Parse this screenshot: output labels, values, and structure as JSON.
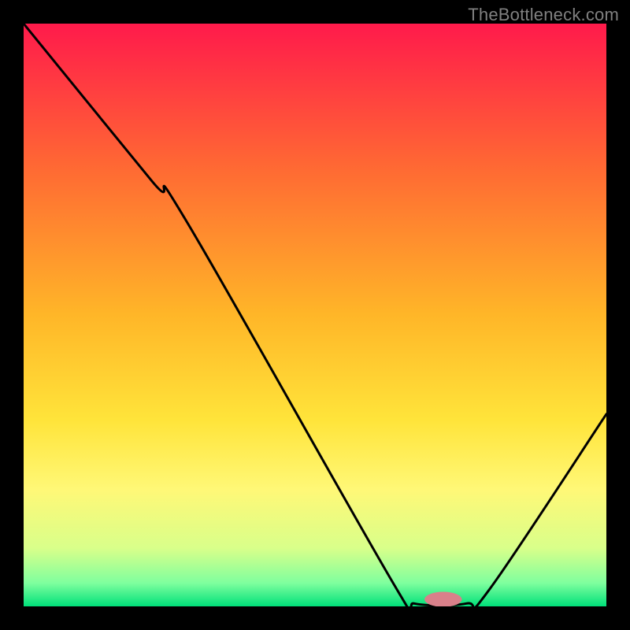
{
  "watermark": "TheBottleneck.com",
  "chart_data": {
    "type": "line",
    "title": "",
    "xlabel": "",
    "ylabel": "",
    "xlim": [
      0,
      100
    ],
    "ylim": [
      0,
      100
    ],
    "background_gradient_stops": [
      {
        "offset": 0,
        "color": "#ff1a4b"
      },
      {
        "offset": 25,
        "color": "#ff6a33"
      },
      {
        "offset": 50,
        "color": "#ffb628"
      },
      {
        "offset": 68,
        "color": "#ffe43a"
      },
      {
        "offset": 80,
        "color": "#fff877"
      },
      {
        "offset": 90,
        "color": "#d9ff8a"
      },
      {
        "offset": 96,
        "color": "#7fff9e"
      },
      {
        "offset": 100,
        "color": "#00e07a"
      }
    ],
    "series": [
      {
        "name": "bottleneck-curve",
        "points": [
          {
            "x": 0,
            "y": 100
          },
          {
            "x": 22,
            "y": 73
          },
          {
            "x": 28,
            "y": 66
          },
          {
            "x": 64,
            "y": 3
          },
          {
            "x": 67,
            "y": 0.5
          },
          {
            "x": 76,
            "y": 0.5
          },
          {
            "x": 80,
            "y": 3
          },
          {
            "x": 100,
            "y": 33
          }
        ]
      }
    ],
    "marker": {
      "x": 72,
      "y": 1.2,
      "color": "#d9808a",
      "rx": 3.2,
      "ry": 1.3
    }
  }
}
